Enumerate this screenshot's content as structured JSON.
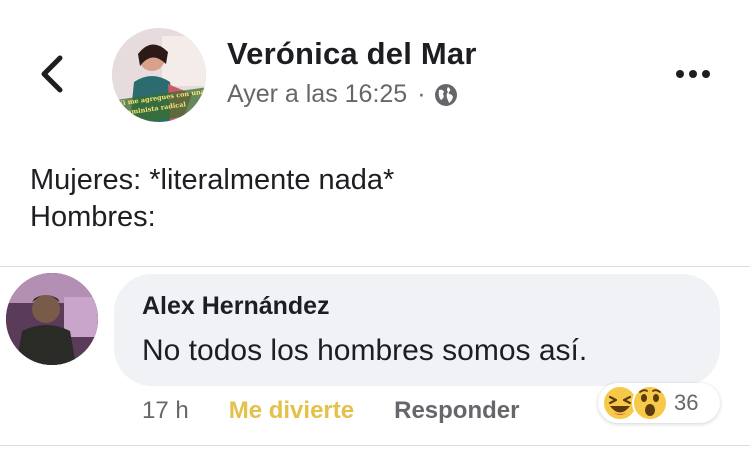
{
  "post": {
    "author": "Verónica del Mar",
    "timestamp": "Ayer a las 16:25",
    "separator": "·",
    "audience_icon": "globe-icon",
    "body_lines": [
      "Mujeres: *literalmente nada*",
      "Hombres:"
    ],
    "avatar_overlay_text": [
      "Ni me agregues con una",
      "feminista radical"
    ]
  },
  "comment": {
    "author": "Alex Hernández",
    "text": "No todos los hombres somos así.",
    "time": "17 h",
    "reaction_label": "Me divierte",
    "reply_label": "Responder",
    "reaction_count": "36",
    "reaction_icons": [
      "haha-emoji-icon",
      "wow-emoji-icon"
    ]
  },
  "colors": {
    "text_primary": "#1c1e21",
    "text_secondary": "#65676b",
    "bubble_bg": "#f0f2f5",
    "haha_label": "#e4c14a",
    "divider": "#dadde1"
  }
}
